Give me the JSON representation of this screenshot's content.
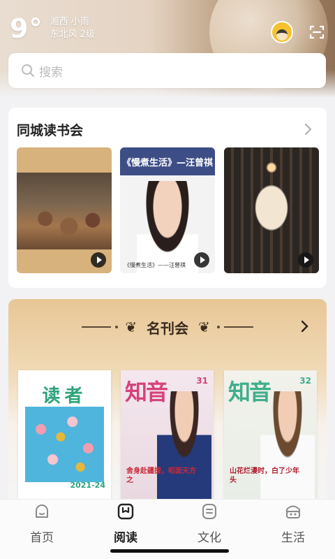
{
  "weather": {
    "temperature": "9°",
    "location_condition": "湘西 小雨",
    "wind": "东北风 2级"
  },
  "search": {
    "placeholder": "搜索"
  },
  "reading_club": {
    "title": "同城读书会",
    "videos": [
      {
        "banner": "",
        "caption": ""
      },
      {
        "banner": "《慢煮生活》—汪曾祺",
        "caption": "《慢煮生活》——汪曾祺"
      },
      {
        "banner": "",
        "caption": ""
      }
    ]
  },
  "magazines": {
    "title": "名刊会",
    "items": [
      {
        "name": "读者",
        "issue": "2021-24",
        "headline": ""
      },
      {
        "name": "知音",
        "issue": "31",
        "headline": "舍身赴疆援，昭面天方之"
      },
      {
        "name": "知音",
        "issue": "32",
        "headline": "山花烂漫时，白了少年头"
      }
    ]
  },
  "tabbar": {
    "tabs": [
      {
        "label": "首页",
        "icon": "home-icon"
      },
      {
        "label": "阅读",
        "icon": "book-icon",
        "active": true
      },
      {
        "label": "文化",
        "icon": "scroll-icon"
      },
      {
        "label": "生活",
        "icon": "life-icon"
      }
    ]
  },
  "colors": {
    "accent": "#f5c12e",
    "magazine_gold": "#e8c796",
    "duzhe_green": "#2ea37a",
    "zhiyin_pink": "#d6427b"
  }
}
